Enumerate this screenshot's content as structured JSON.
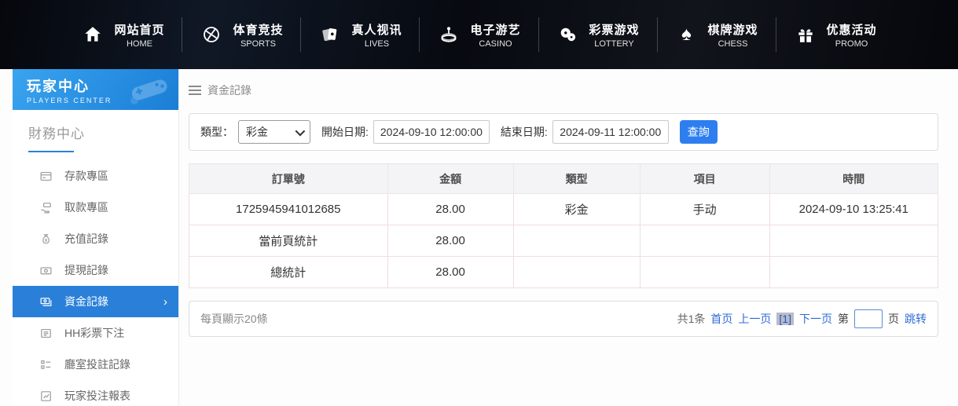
{
  "colors": {
    "accent_blue": "#2a80d9",
    "button_blue": "#2e7ef0",
    "link_blue": "#2f6bd8",
    "nav_bg": "#0a0e16"
  },
  "nav": {
    "items": [
      {
        "zh": "网站首页",
        "en": "HOME",
        "icon": "home-icon"
      },
      {
        "zh": "体育竞技",
        "en": "SPORTS",
        "icon": "basketball-icon"
      },
      {
        "zh": "真人视讯",
        "en": "LIVES",
        "icon": "cards-icon"
      },
      {
        "zh": "电子游艺",
        "en": "CASINO",
        "icon": "roulette-icon"
      },
      {
        "zh": "彩票游戏",
        "en": "LOTTERY",
        "icon": "lottery-balls-icon"
      },
      {
        "zh": "棋牌游戏",
        "en": "CHESS",
        "icon": "spade-icon"
      },
      {
        "zh": "优惠活动",
        "en": "PROMO",
        "icon": "gift-icon"
      }
    ]
  },
  "sidebar": {
    "title_zh": "玩家中心",
    "title_en": "PLAYERS CENTER",
    "section_title": "財務中心",
    "items": [
      {
        "label": "存款專區",
        "icon": "deposit-card-icon"
      },
      {
        "label": "取款專區",
        "icon": "withdraw-hand-icon"
      },
      {
        "label": "充值記錄",
        "icon": "money-bag-icon"
      },
      {
        "label": "提現記錄",
        "icon": "banknote-icon"
      },
      {
        "label": "資金記錄",
        "icon": "funds-icon",
        "active": true
      },
      {
        "label": "HH彩票下注",
        "icon": "newspaper-icon"
      },
      {
        "label": "廳室投註記錄",
        "icon": "checklist-icon"
      },
      {
        "label": "玩家投注報表",
        "icon": "report-chart-icon"
      }
    ],
    "active_chevron": "›"
  },
  "breadcrumb": {
    "title": "資金記錄"
  },
  "filter": {
    "type_label": "類型：",
    "type_value": "彩金",
    "start_label": "開始日期:",
    "start_value": "2024-09-10 12:00:00",
    "end_label": "結束日期:",
    "end_value": "2024-09-11 12:00:00",
    "search_label": "查詢"
  },
  "table": {
    "headers": [
      "訂單號",
      "金額",
      "類型",
      "項目",
      "時間"
    ],
    "rows": [
      [
        "1725945941012685",
        "28.00",
        "彩金",
        "手动",
        "2024-09-10 13:25:41"
      ],
      [
        "當前頁統計",
        "28.00",
        "",
        "",
        ""
      ],
      [
        "總統計",
        "28.00",
        "",
        "",
        ""
      ]
    ]
  },
  "pagination": {
    "page_size_text": "每頁顯示20條",
    "total_text": "共1条",
    "first_label": "首页",
    "prev_label": "上一页",
    "current_label": "[1]",
    "next_label": "下一页",
    "jump_prefix": "第",
    "jump_value": "",
    "jump_suffix": "页",
    "jump_go_label": "跳转"
  }
}
